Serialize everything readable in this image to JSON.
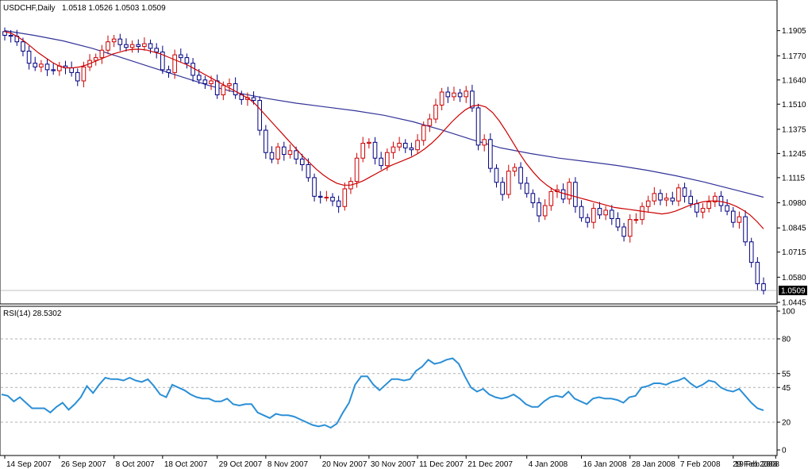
{
  "chart_data": [
    {
      "type": "candlestick",
      "title": "USDCHF,Daily",
      "ohlc_header": [
        "1.0518",
        "1.0526",
        "1.0503",
        "1.0509"
      ],
      "current_price_label": "1.0509",
      "y_ticks": [
        "1.1905",
        "1.1770",
        "1.1640",
        "1.1510",
        "1.1375",
        "1.1245",
        "1.1115",
        "1.0980",
        "1.0845",
        "1.0715",
        "1.0580",
        "1.0445"
      ],
      "ylim": [
        1.0445,
        1.201
      ],
      "x_labels": [
        "14 Sep 2007",
        "26 Sep 2007",
        "8 Oct 2007",
        "18 Oct 2007",
        "29 Oct 2007",
        "8 Nov 2007",
        "20 Nov 2007",
        "30 Nov 2007",
        "11 Dec 2007",
        "21 Dec 2007",
        "4 Jan 2008",
        "16 Jan 2008",
        "28 Jan 2008",
        "7 Feb 2008",
        "19 Feb 2008",
        "29 Feb 2008"
      ],
      "x_label_bar_index": [
        0,
        9,
        18,
        26,
        35,
        43,
        52,
        60,
        68,
        76,
        86,
        95,
        103,
        111,
        120,
        127
      ],
      "close": [
        1.188,
        1.1875,
        1.1845,
        1.1795,
        1.173,
        1.171,
        1.1725,
        1.1695,
        1.169,
        1.1715,
        1.1705,
        1.168,
        1.1635,
        1.171,
        1.1745,
        1.176,
        1.18,
        1.1845,
        1.186,
        1.183,
        1.1815,
        1.183,
        1.182,
        1.1835,
        1.181,
        1.179,
        1.1695,
        1.168,
        1.1775,
        1.176,
        1.173,
        1.1665,
        1.164,
        1.162,
        1.1635,
        1.156,
        1.161,
        1.162,
        1.156,
        1.1535,
        1.1545,
        1.153,
        1.137,
        1.125,
        1.1215,
        1.128,
        1.124,
        1.126,
        1.1215,
        1.1185,
        1.1115,
        1.1015,
        1.101,
        1.101,
        1.099,
        1.096,
        1.1055,
        1.1095,
        1.122,
        1.13,
        1.1305,
        1.122,
        1.118,
        1.125,
        1.128,
        1.13,
        1.1275,
        1.1265,
        1.1315,
        1.1395,
        1.143,
        1.1505,
        1.1575,
        1.155,
        1.157,
        1.155,
        1.158,
        1.149,
        1.129,
        1.132,
        1.1165,
        1.109,
        1.1025,
        1.115,
        1.117,
        1.1085,
        1.103,
        1.098,
        1.091,
        1.0965,
        1.104,
        1.105,
        1.1,
        1.109,
        1.096,
        1.09,
        1.0875,
        1.095,
        1.0915,
        1.094,
        1.0895,
        1.085,
        1.08,
        1.089,
        1.089,
        1.096,
        1.099,
        1.103,
        1.0995,
        1.1005,
        1.099,
        1.106,
        1.1015,
        1.0975,
        1.093,
        1.095,
        1.0985,
        1.1015,
        1.0965,
        1.0935,
        1.0875,
        1.0905,
        1.077,
        1.066,
        1.0545,
        1.0509
      ],
      "line_overlay_1": {
        "color": "#cc0000",
        "values": [
          1.19,
          1.189,
          1.187,
          1.1845,
          1.1815,
          1.1785,
          1.176,
          1.1735,
          1.1715,
          1.1705,
          1.1705,
          1.171,
          1.172,
          1.1735,
          1.175,
          1.1765,
          1.178,
          1.179,
          1.18,
          1.1805,
          1.1805,
          1.18,
          1.179,
          1.178,
          1.1765,
          1.175,
          1.1735,
          1.172,
          1.17,
          1.168,
          1.166,
          1.164,
          1.162,
          1.16,
          1.158,
          1.156,
          1.154,
          1.151,
          1.147,
          1.143,
          1.139,
          1.135,
          1.131,
          1.127,
          1.123,
          1.1195,
          1.116,
          1.113,
          1.1105,
          1.1085,
          1.1075,
          1.1075,
          1.1085,
          1.11,
          1.112,
          1.114,
          1.116,
          1.118,
          1.1195,
          1.121,
          1.1225,
          1.1245,
          1.127,
          1.13,
          1.1335,
          1.1375,
          1.1415,
          1.145,
          1.148,
          1.15,
          1.1505,
          1.1495,
          1.1465,
          1.142,
          1.1365,
          1.1305,
          1.1245,
          1.119,
          1.1145,
          1.1105,
          1.1075,
          1.105,
          1.1035,
          1.1025,
          1.1015,
          1.1005,
          1.0995,
          1.0985,
          1.0975,
          1.0965,
          1.0955,
          1.095,
          1.0945,
          1.094,
          1.0935,
          1.093,
          1.0925,
          1.092,
          1.0925,
          1.0935,
          1.095,
          1.0965,
          1.0975,
          1.0985,
          1.099,
          1.099,
          1.0985,
          1.0975,
          1.096,
          1.094,
          1.0915,
          1.088,
          1.084
        ]
      },
      "line_overlay_2": {
        "color": "#333399",
        "values": [
          1.1905,
          1.188,
          1.185,
          1.181,
          1.176,
          1.171,
          1.166,
          1.161,
          1.157,
          1.154,
          1.1515,
          1.1495,
          1.1475,
          1.145,
          1.1415,
          1.137,
          1.132,
          1.1275,
          1.1245,
          1.122,
          1.12,
          1.118,
          1.1155,
          1.1125,
          1.109,
          1.105,
          1.101
        ]
      }
    },
    {
      "type": "line",
      "title": "RSI(14) 28.5302",
      "y_ticks": [
        "100",
        "80",
        "55",
        "45",
        "20",
        "0"
      ],
      "dashed_levels": [
        80,
        55,
        45,
        20
      ],
      "ylim": [
        0,
        100
      ],
      "series": [
        {
          "color": "#2b8fd6",
          "values": [
            40,
            39,
            35,
            38,
            34,
            30,
            30,
            30,
            27,
            31,
            34,
            29,
            33,
            38,
            46,
            41,
            47,
            52,
            51,
            51,
            50,
            52,
            50,
            49,
            51,
            46,
            40,
            38,
            47,
            45,
            43,
            40,
            38,
            37,
            37,
            35,
            35,
            37,
            33,
            32,
            33,
            33,
            27,
            25,
            23,
            26,
            25,
            25,
            24,
            22,
            20,
            18,
            17,
            18,
            16,
            19,
            27,
            34,
            47,
            53,
            53,
            47,
            43,
            47,
            51,
            51,
            50,
            51,
            57,
            60,
            65,
            62,
            63,
            65,
            66,
            62,
            53,
            45,
            42,
            44,
            40,
            38,
            37,
            38,
            40,
            37,
            33,
            31,
            31,
            35,
            38,
            39,
            38,
            42,
            37,
            35,
            33,
            37,
            38,
            37,
            37,
            36,
            34,
            38,
            39,
            45,
            46,
            48,
            48,
            47,
            49,
            50,
            52,
            48,
            45,
            47,
            50,
            49,
            45,
            43,
            42,
            44,
            39,
            34,
            30,
            28.5
          ]
        }
      ]
    }
  ]
}
